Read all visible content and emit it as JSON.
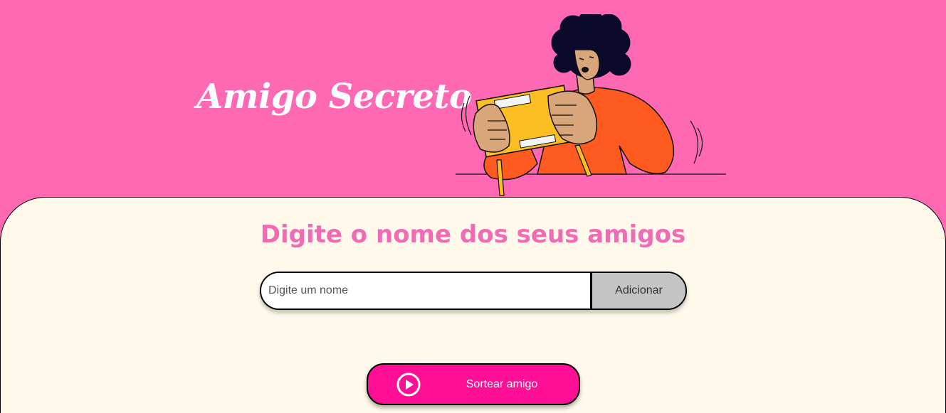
{
  "header": {
    "title": "Amigo Secreto",
    "illustration": "person-opening-gift-illustration"
  },
  "main": {
    "subtitle": "Digite o nome dos seus amigos",
    "name_input": {
      "value": "",
      "placeholder": "Digite um nome"
    },
    "add_button_label": "Adicionar",
    "draw_button": {
      "label": "Sortear amigo",
      "icon": "play-circle-icon"
    }
  },
  "colors": {
    "header_background": "#ff69b4",
    "panel_background": "#fff9eb",
    "subtitle": "#f06bb4",
    "draw_button": "#fe0f96",
    "add_button": "#c4c4c4"
  }
}
